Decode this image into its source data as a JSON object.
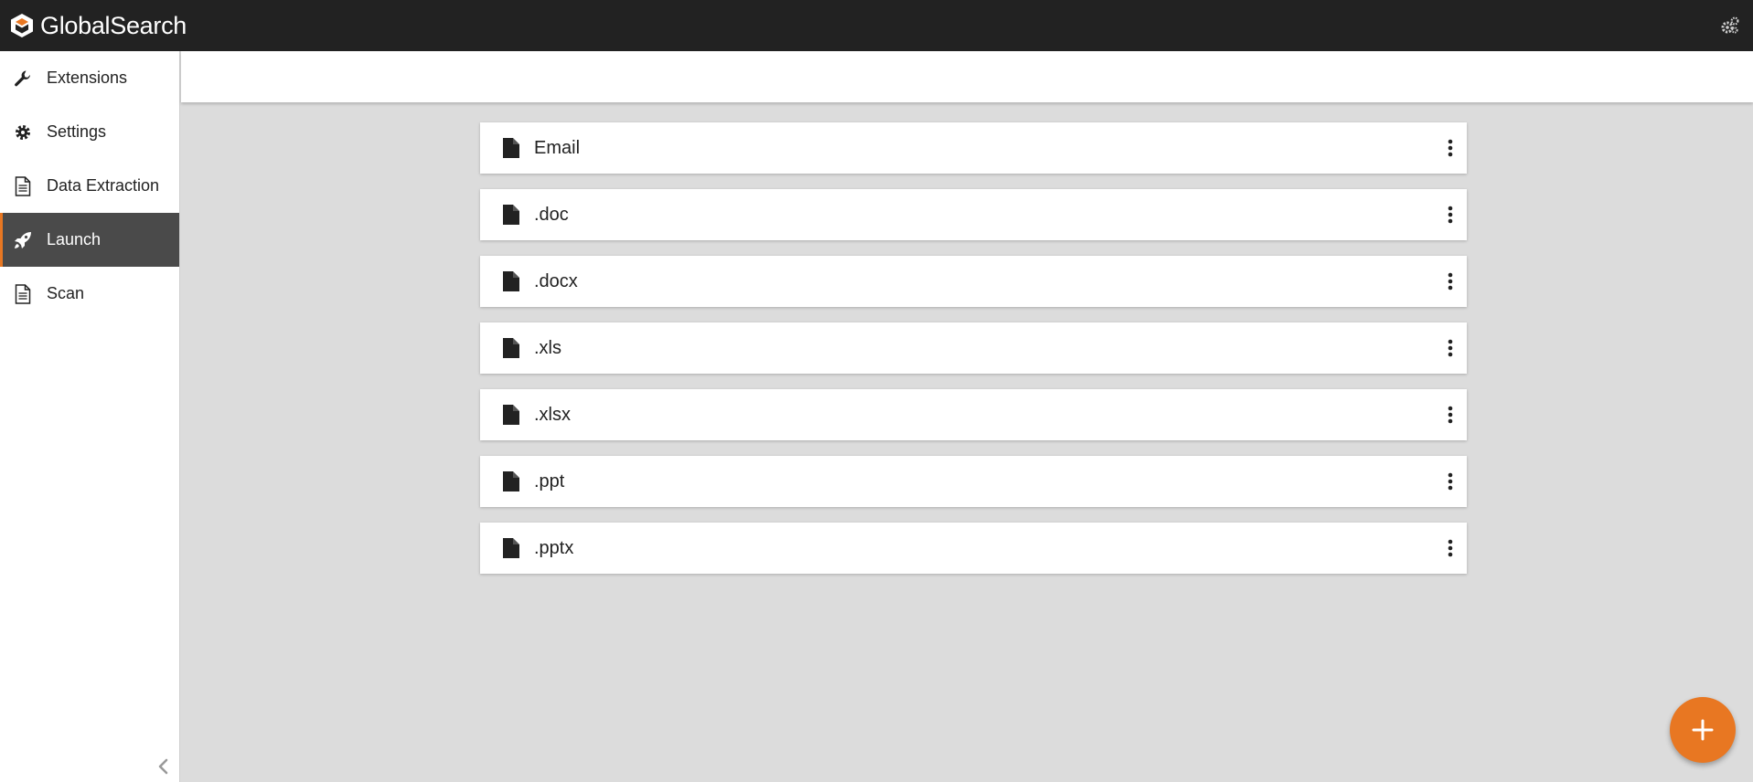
{
  "app": {
    "title": "GlobalSearch"
  },
  "topbar": {
    "settings_icon": "gears-icon"
  },
  "sidebar": {
    "items": [
      {
        "label": "Extensions",
        "icon": "wrench-icon",
        "active": false
      },
      {
        "label": "Settings",
        "icon": "gear-icon",
        "active": false
      },
      {
        "label": "Data Extraction",
        "icon": "document-icon",
        "active": false
      },
      {
        "label": "Launch",
        "icon": "rocket-icon",
        "active": true
      },
      {
        "label": "Scan",
        "icon": "document-icon",
        "active": false
      }
    ],
    "collapse_icon": "chevron-left-icon"
  },
  "list": {
    "items": [
      {
        "label": "Email",
        "icon": "file-icon"
      },
      {
        "label": ".doc",
        "icon": "file-icon"
      },
      {
        "label": ".docx",
        "icon": "file-icon"
      },
      {
        "label": ".xls",
        "icon": "file-icon"
      },
      {
        "label": ".xlsx",
        "icon": "file-icon"
      },
      {
        "label": ".ppt",
        "icon": "file-icon"
      },
      {
        "label": ".pptx",
        "icon": "file-icon"
      }
    ]
  },
  "fab": {
    "icon": "plus-icon"
  },
  "colors": {
    "accent": "#e87722",
    "topbar": "#222222",
    "active_nav": "#4a4a4a",
    "background": "#dcdcdc"
  }
}
